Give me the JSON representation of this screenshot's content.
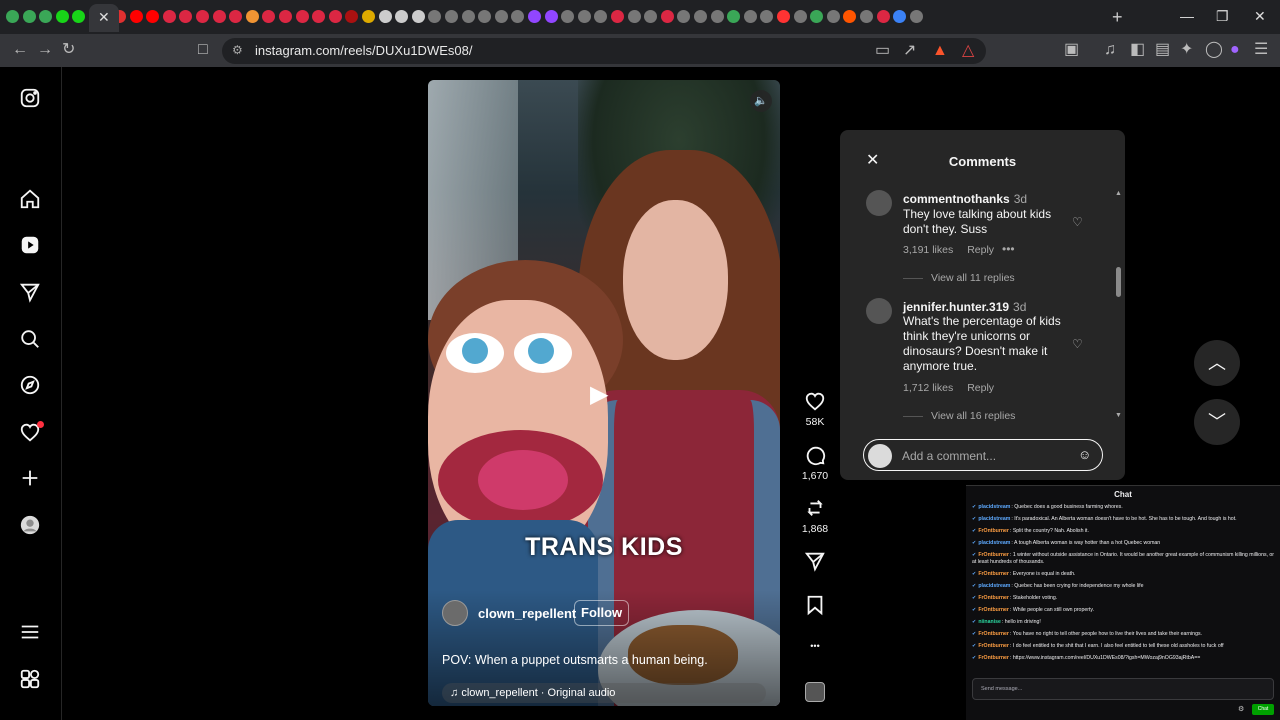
{
  "browser": {
    "url": "instagram.com/reels/DUXu1DWEs08/",
    "active_tab_close": "✕",
    "new_tab": "+",
    "brave_badge": "1",
    "tab_favicon_colors": [
      "#3aa757",
      "#3aa757",
      "#3aa757",
      "#18d518",
      "#18d518",
      "#e03030",
      "#ff0000",
      "#ff0000",
      "#dc2743",
      "#dc2743",
      "#dc2743",
      "#dc2743",
      "#dc2743",
      "#f09433",
      "#dc2743",
      "#dc2743",
      "#dc2743",
      "#dc2743",
      "#dc2743",
      "#aa1111",
      "#ddaa00",
      "#cccccc",
      "#cccccc",
      "#cccccc",
      "#777777",
      "#777777",
      "#777777",
      "#777777",
      "#777777",
      "#777777",
      "#9146ff",
      "#9146ff",
      "#777777",
      "#777777",
      "#777777",
      "#dc2743",
      "#777777",
      "#777777",
      "#dc2743",
      "#777777",
      "#777777",
      "#777777",
      "#3aa757",
      "#777777",
      "#777777",
      "#ff3333",
      "#777777",
      "#3aa757",
      "#777777",
      "#ff5500",
      "#777777",
      "#dc2743",
      "#3b82f6",
      "#777777"
    ]
  },
  "sidenav": {
    "items": [
      "instagram-logo-icon",
      "home-icon",
      "reels-icon",
      "messages-icon",
      "search-icon",
      "explore-icon",
      "notifications-icon",
      "create-icon",
      "profile-icon",
      "menu-icon",
      "also-from-meta-icon"
    ]
  },
  "reel": {
    "overlay_text": "TRANS KIDS",
    "author": "clown_repellent",
    "follow_label": "Follow",
    "description": "POV: When a puppet outsmarts a human being.",
    "audio": "clown_repellent · Original audio",
    "mute_icon": "🔈",
    "play_icon": "▶"
  },
  "actions": {
    "likes": "58K",
    "comments": "1,670",
    "reposts": "1,868",
    "more": "•••"
  },
  "comments_panel": {
    "title": "Comments",
    "close": "✕",
    "items": [
      {
        "user": "commentnothanks",
        "time": "3d",
        "text": "They love talking about kids don't they. Suss",
        "likes": "3,191 likes",
        "reply": "Reply",
        "more": "•••",
        "replies": "View all 11 replies"
      },
      {
        "user": "jennifer.hunter.319",
        "time": "3d",
        "text": "What's the percentage of kids think they're unicorns or dinosaurs? Doesn't make it anymore true.",
        "likes": "1,712 likes",
        "reply": "Reply",
        "replies": "View all 16 replies"
      }
    ],
    "input_placeholder": "Add a comment...",
    "heart_icon": "♡",
    "emoji_icon": "☺"
  },
  "reel_nav": {
    "up": "︿",
    "down": "﹀"
  },
  "chat": {
    "title": "Chat",
    "messages": [
      {
        "user": "placidstream",
        "text": "Quebec does a good business farming whores."
      },
      {
        "user": "placidstream",
        "text": "It's paradoxical. An Alberta woman doesn't have to be hot. She has to be tough. And tough is hot."
      },
      {
        "user": "FrOntburner",
        "text": "Split the country? Nah. Abolish it."
      },
      {
        "user": "placidstream",
        "text": "A tough Alberta woman is way hotter than a hot Quebec woman"
      },
      {
        "user": "FrOntburner",
        "text": "1 winter without outside assistance in Ontario. It would be another great example of communism killing millions, or at least hundreds of thousands."
      },
      {
        "user": "FrOntburner",
        "text": "Everyone is equal in death."
      },
      {
        "user": "placidstream",
        "text": "Quebec has been crying for independence my whole life"
      },
      {
        "user": "FrOntburner",
        "text": "Stakeholder voting."
      },
      {
        "user": "FrOntburner",
        "text": "While people can still own property."
      },
      {
        "user": "niinanise",
        "text": "hello im driving!"
      },
      {
        "user": "FrOntburner",
        "text": "You have no right to tell other people how to live their lives and take their earnings."
      },
      {
        "user": "FrOntburner",
        "text": "I do feel entitled to the shit that I earn. I also feel entitled to tell these old assholes to fuck off"
      },
      {
        "user": "FrOntburner",
        "text": "https://www.instagram.com/reel/DUXu1DWEs08/?igsh=MWozaj9nOG93ajRtbA=="
      }
    ],
    "input_placeholder": "Send message...",
    "send_label": "Chat",
    "user_colors": {
      "placidstream": "#5eaaff",
      "FrOntburner": "#ff9f43",
      "niinanise": "#2bd9a0"
    }
  }
}
